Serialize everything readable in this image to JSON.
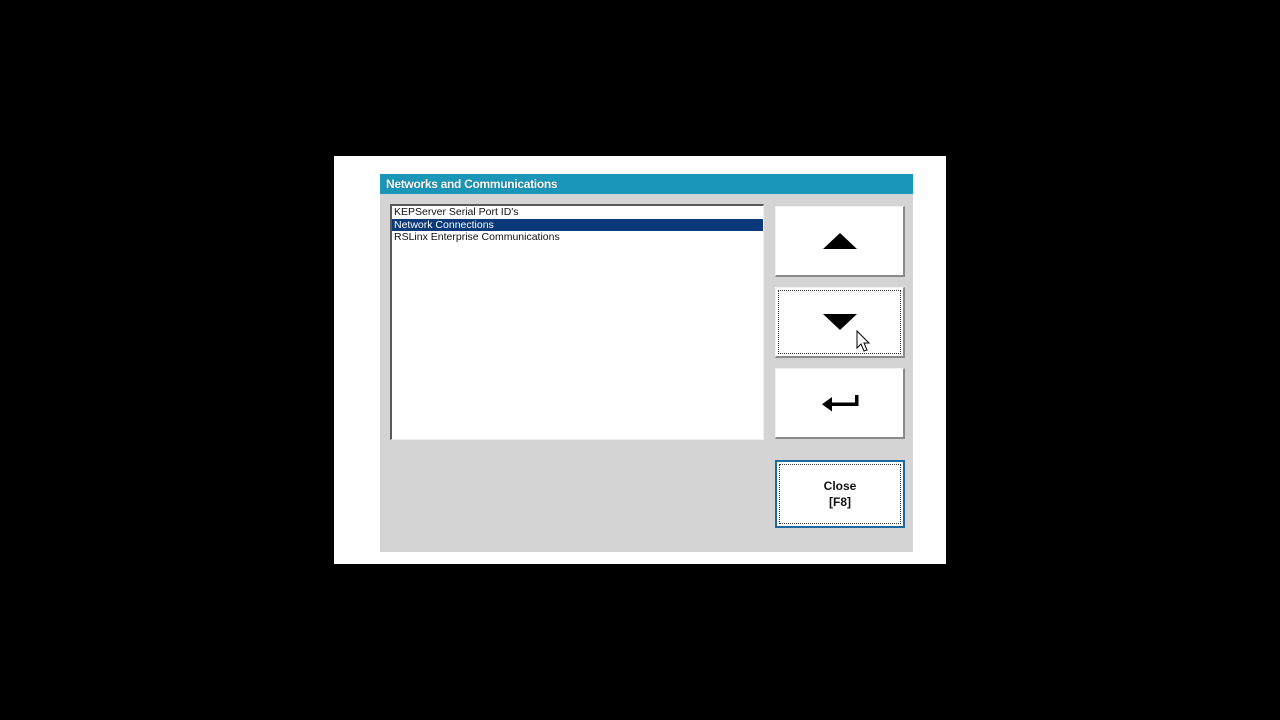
{
  "dialog": {
    "title": "Networks and Communications"
  },
  "list": {
    "items": [
      {
        "label": "KEPServer Serial Port ID's",
        "selected": false
      },
      {
        "label": "Network Connections",
        "selected": true
      },
      {
        "label": "RSLinx Enterprise Communications",
        "selected": false
      }
    ]
  },
  "buttons": {
    "up_icon": "triangle-up-icon",
    "down_icon": "triangle-down-icon",
    "enter_icon": "enter-return-icon",
    "close_line1": "Close",
    "close_line2": "[F8]"
  },
  "colors": {
    "titlebar": "#1a96b8",
    "selection": "#0a3a7a",
    "dialog_bg": "#d4d4d4"
  }
}
